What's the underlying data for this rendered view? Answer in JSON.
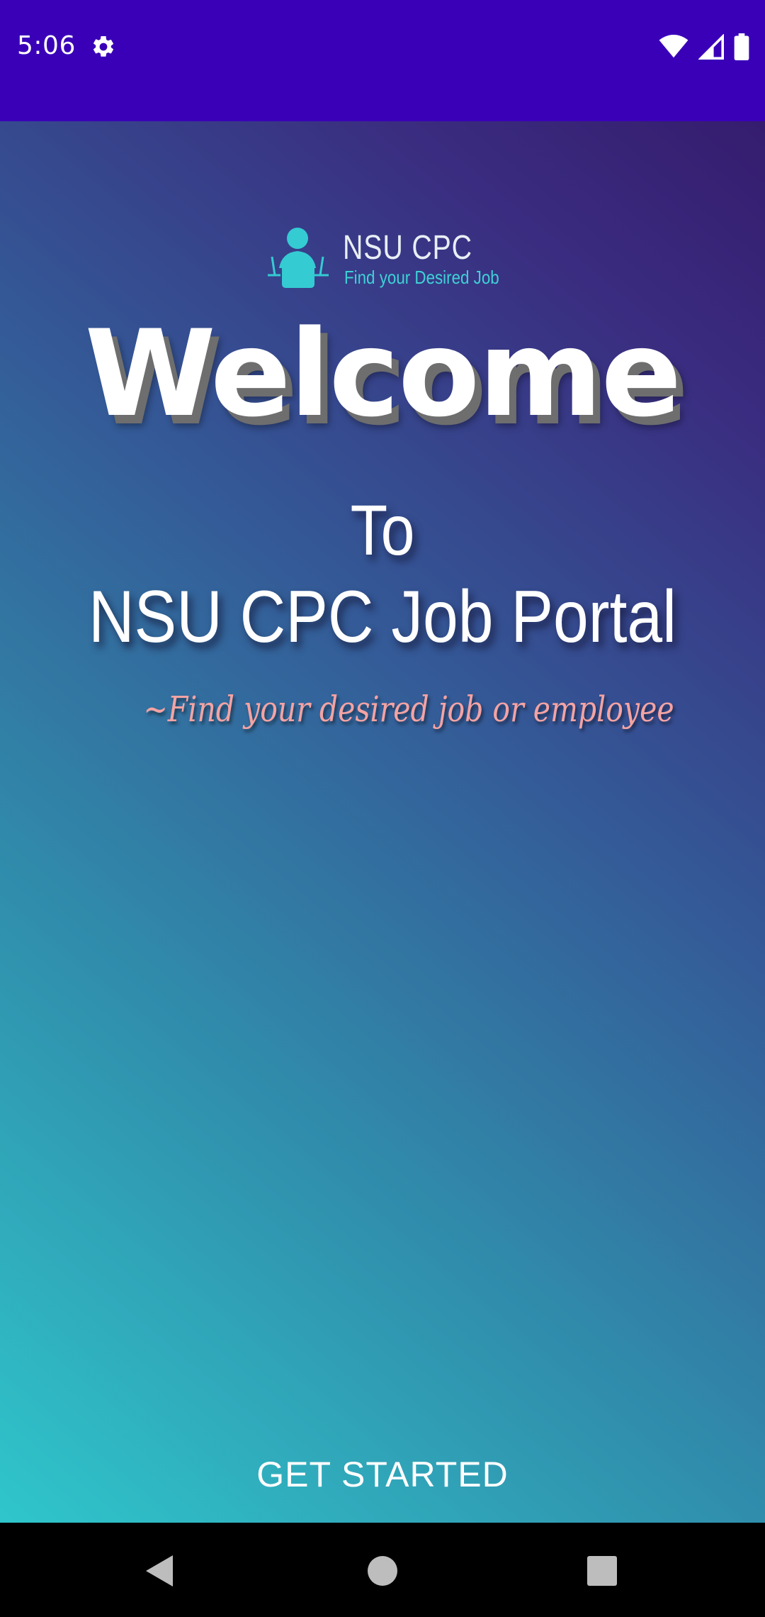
{
  "status_bar": {
    "time": "5:06",
    "icons": [
      "gear-icon",
      "wifi-icon",
      "signal-icon",
      "battery-icon"
    ],
    "background": "#3a00b8"
  },
  "logo": {
    "title": "NSU CPC",
    "tagline": "Find your Desired Job",
    "icon": "person-at-laptop-icon"
  },
  "hero": {
    "welcome": "Welcome",
    "to": "To",
    "portal_name": "NSU CPC Job Portal",
    "subtitle": "~Find your desired job or employee"
  },
  "actions": {
    "get_started_label": "GET STARTED"
  },
  "nav_bar": {
    "buttons": [
      "back-icon",
      "home-icon",
      "recents-icon"
    ]
  },
  "colors": {
    "gradient_start": "#2fc6cb",
    "gradient_end": "#351c6e",
    "accent": "#3fd1d6",
    "subtitle": "#f4a3a3"
  }
}
